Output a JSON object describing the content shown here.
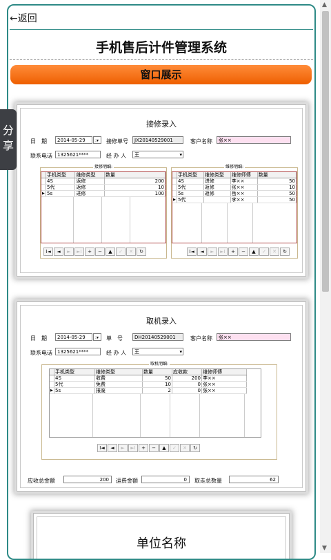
{
  "header": {
    "back_label": "←返回",
    "title": "手机售后计件管理系统",
    "banner": "窗口展示",
    "share": "分享"
  },
  "form1": {
    "title": "接修录入",
    "date_label": "日　期",
    "date_value": "2014-05-29",
    "order_label": "接修单号",
    "order_value": "JX20140529001",
    "customer_label": "客户名称",
    "customer_value": "张××",
    "phone_label": "联系电话",
    "phone_value": "1325621****",
    "handler_label": "经 办 人",
    "handler_value": "王",
    "left_group": "接修明细:",
    "right_group": "维修明细:",
    "left_headers": [
      "手机类型",
      "维修类型",
      "数量"
    ],
    "left_rows": [
      [
        "4S",
        "返修",
        "200"
      ],
      [
        "5代",
        "返修",
        "10"
      ],
      [
        "5s",
        "进修",
        "100"
      ]
    ],
    "right_headers": [
      "手机类型",
      "维修类型",
      "维修师傅",
      "数量"
    ],
    "right_rows": [
      [
        "4S",
        "进修",
        "李××",
        "50"
      ],
      [
        "5代",
        "返修",
        "张××",
        "10"
      ],
      [
        "5s",
        "返修",
        "岳××",
        "50"
      ],
      [
        "5代",
        "",
        "李××",
        "50"
      ]
    ]
  },
  "form2": {
    "title": "取机录入",
    "date_label": "日　期",
    "date_value": "2014-05-29",
    "order_label": "单　号",
    "order_value": "DH20140529001",
    "customer_label": "客户名称",
    "customer_value": "张××",
    "phone_label": "联系电话",
    "phone_value": "1325621****",
    "handler_label": "经 办 人",
    "handler_value": "王",
    "group": "取机明细:",
    "headers": [
      "手机类型",
      "维修类型",
      "数量",
      "应收款",
      "维修师傅"
    ],
    "rows": [
      [
        "4S",
        "收费",
        "50",
        "200",
        "李××"
      ],
      [
        "5代",
        "免费",
        "10",
        "0",
        "张××"
      ],
      [
        "5s",
        "报废",
        "2",
        "0",
        "张××"
      ]
    ],
    "total_receivable_label": "应收总金额",
    "total_receivable_value": "200",
    "shipping_label": "运费金额",
    "shipping_value": "0",
    "pickup_total_label": "取走总数量",
    "pickup_total_value": "62"
  },
  "form3": {
    "title": "单位名称"
  },
  "nav_buttons": [
    "I◄",
    "◄",
    "►",
    "►I",
    "+",
    "−",
    "▲",
    "✓",
    "✕",
    "↻"
  ]
}
